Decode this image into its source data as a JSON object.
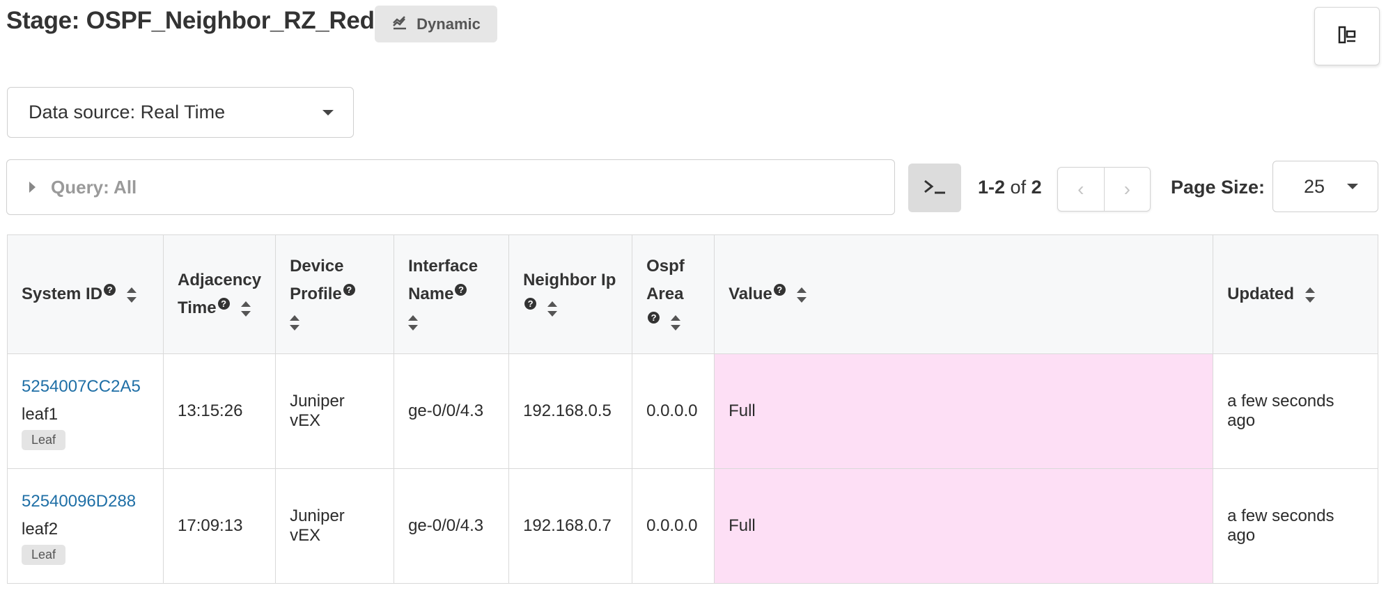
{
  "header": {
    "title": "Stage: OSPF_Neighbor_RZ_Red",
    "badge_label": "Dynamic"
  },
  "data_source": {
    "label": "Data source: Real Time"
  },
  "query": {
    "label": "Query: All"
  },
  "paging": {
    "range": "1-2",
    "of_label": "of",
    "total": "2",
    "page_size_label": "Page Size:",
    "page_size": "25"
  },
  "table": {
    "columns": [
      {
        "label": "System ID"
      },
      {
        "label": "Adjacency Time"
      },
      {
        "label": "Device Profile"
      },
      {
        "label": "Interface Name"
      },
      {
        "label": "Neighbor Ip"
      },
      {
        "label": "Ospf Area"
      },
      {
        "label": "Value"
      },
      {
        "label": "Updated"
      }
    ],
    "rows": [
      {
        "system_id": "5254007CC2A5",
        "system_name": "leaf1",
        "role": "Leaf",
        "adjacency_time": "13:15:26",
        "device_profile": "Juniper vEX",
        "interface_name": "ge-0/0/4.3",
        "neighbor_ip": "192.168.0.5",
        "ospf_area": "0.0.0.0",
        "value": "Full",
        "updated": "a few seconds ago"
      },
      {
        "system_id": "52540096D288",
        "system_name": "leaf2",
        "role": "Leaf",
        "adjacency_time": "17:09:13",
        "device_profile": "Juniper vEX",
        "interface_name": "ge-0/0/4.3",
        "neighbor_ip": "192.168.0.7",
        "ospf_area": "0.0.0.0",
        "value": "Full",
        "updated": "a few seconds ago"
      }
    ]
  },
  "colors": {
    "link": "#1f6fa6",
    "value_bg": "#fddff5",
    "value_text": "#d9579b"
  },
  "icons": [
    "dynamic-chart-icon",
    "layout-toggle-icon",
    "caret-down-icon",
    "caret-right-icon",
    "terminal-icon",
    "chevron-left-icon",
    "chevron-right-icon",
    "help-icon",
    "sort-icon"
  ]
}
